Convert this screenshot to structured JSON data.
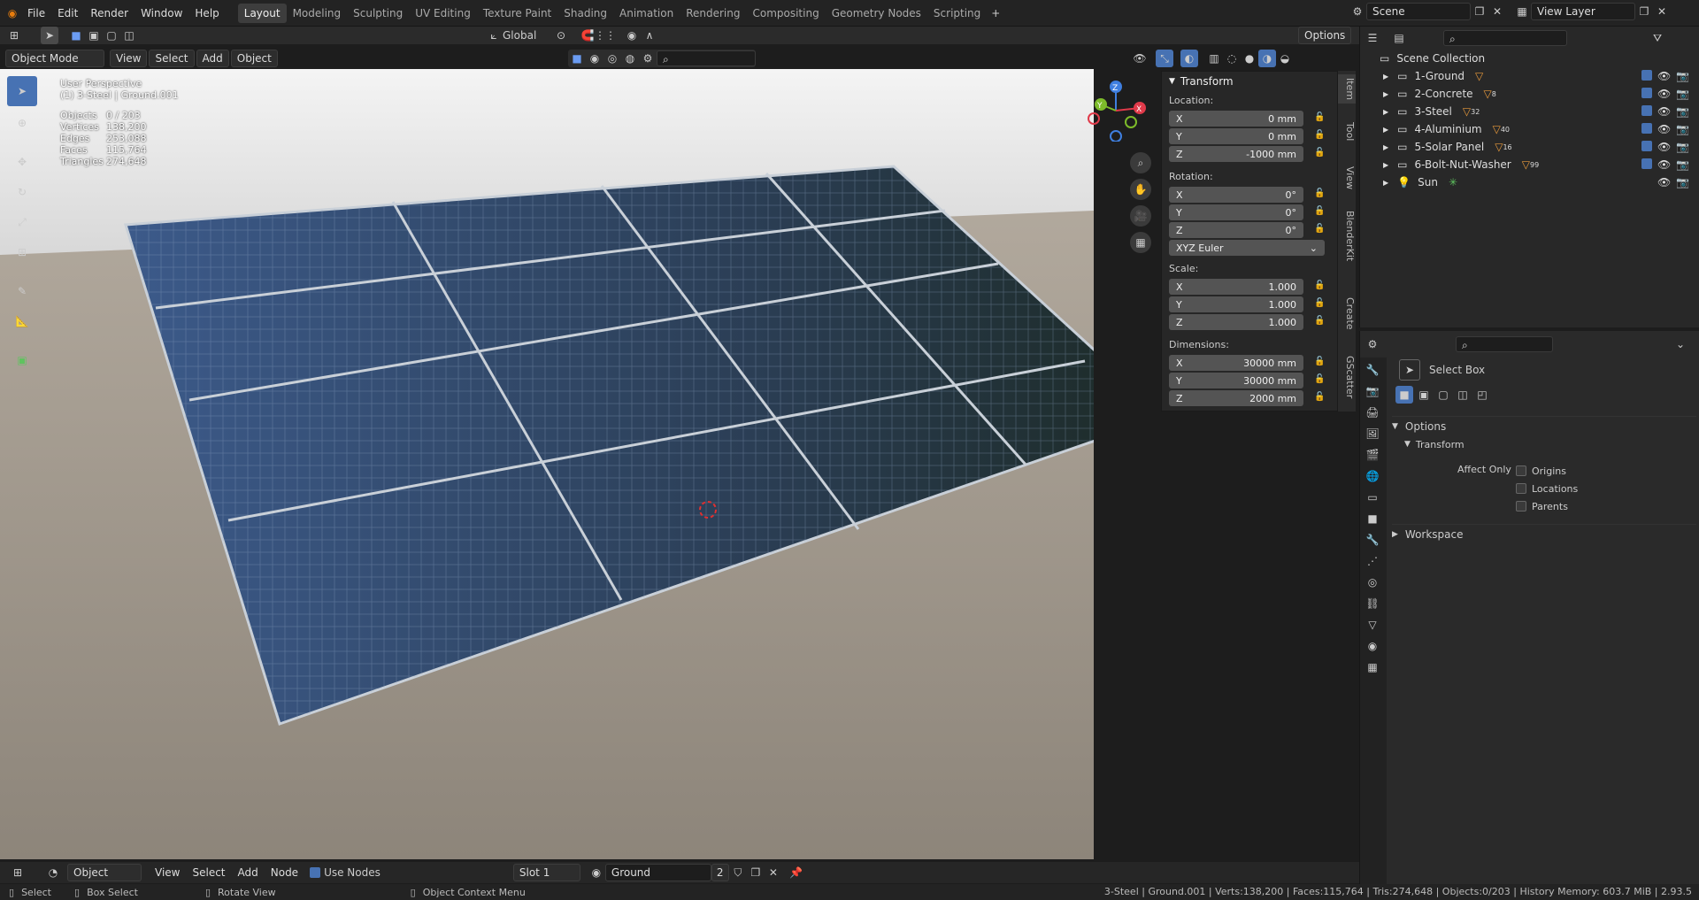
{
  "menus": [
    "File",
    "Edit",
    "Render",
    "Window",
    "Help"
  ],
  "workspaces": [
    "Layout",
    "Modeling",
    "Sculpting",
    "UV Editing",
    "Texture Paint",
    "Shading",
    "Animation",
    "Rendering",
    "Compositing",
    "Geometry Nodes",
    "Scripting"
  ],
  "active_workspace": "Layout",
  "scene": "Scene",
  "view_layer": "View Layer",
  "viewport_header": {
    "mode": "Object Mode",
    "menus": [
      "View",
      "Select",
      "Add",
      "Object"
    ],
    "transform_orientation": "Global",
    "options": "Options"
  },
  "overlay_text": {
    "perspective": "User Perspective",
    "active": "(1) 3-Steel | Ground.001",
    "stats": [
      {
        "label": "Objects",
        "value": "0 / 203"
      },
      {
        "label": "Vertices",
        "value": "138,200"
      },
      {
        "label": "Edges",
        "value": "253,088"
      },
      {
        "label": "Faces",
        "value": "115,764"
      },
      {
        "label": "Triangles",
        "value": "274,648"
      }
    ]
  },
  "npanel": {
    "title": "Transform",
    "location_label": "Location:",
    "location": [
      {
        "axis": "X",
        "value": "0 mm"
      },
      {
        "axis": "Y",
        "value": "0 mm"
      },
      {
        "axis": "Z",
        "value": "-1000 mm"
      }
    ],
    "rotation_label": "Rotation:",
    "rotation": [
      {
        "axis": "X",
        "value": "0°"
      },
      {
        "axis": "Y",
        "value": "0°"
      },
      {
        "axis": "Z",
        "value": "0°"
      }
    ],
    "rotation_mode": "XYZ Euler",
    "scale_label": "Scale:",
    "scale": [
      {
        "axis": "X",
        "value": "1.000"
      },
      {
        "axis": "Y",
        "value": "1.000"
      },
      {
        "axis": "Z",
        "value": "1.000"
      }
    ],
    "dimensions_label": "Dimensions:",
    "dimensions": [
      {
        "axis": "X",
        "value": "30000 mm"
      },
      {
        "axis": "Y",
        "value": "30000 mm"
      },
      {
        "axis": "Z",
        "value": "2000 mm"
      }
    ],
    "tabs": [
      "Item",
      "Tool",
      "View",
      "BlenderKit",
      "Create",
      "GScatter"
    ]
  },
  "outliner": {
    "root": "Scene Collection",
    "items": [
      {
        "name": "1-Ground",
        "badge": ""
      },
      {
        "name": "2-Concrete",
        "badge": "8"
      },
      {
        "name": "3-Steel",
        "badge": "32"
      },
      {
        "name": "4-Aluminium",
        "badge": "40"
      },
      {
        "name": "5-Solar Panel",
        "badge": "16"
      },
      {
        "name": "6-Bolt-Nut-Washer",
        "badge": "99"
      },
      {
        "name": "Sun",
        "badge": ""
      }
    ]
  },
  "properties": {
    "tool": "Select Box",
    "options": "Options",
    "transform": "Transform",
    "affect_only": "Affect Only",
    "checks": [
      "Origins",
      "Locations",
      "Parents"
    ],
    "workspace": "Workspace"
  },
  "bottom_header": {
    "mode": "Object",
    "menus": [
      "View",
      "Select",
      "Add",
      "Node"
    ],
    "use_nodes": "Use Nodes",
    "slot": "Slot 1",
    "material": "Ground",
    "users": "2"
  },
  "statusbar": {
    "select": "Select",
    "box_select": "Box Select",
    "rotate": "Rotate View",
    "context": "Object Context Menu",
    "info": "3-Steel | Ground.001 | Verts:138,200 | Faces:115,764 | Tris:274,648 | Objects:0/203 | History Memory: 603.7 MiB | 2.93.5"
  },
  "colors": {
    "accent": "#4772b3",
    "header": "#232323",
    "panel": "#282828"
  }
}
